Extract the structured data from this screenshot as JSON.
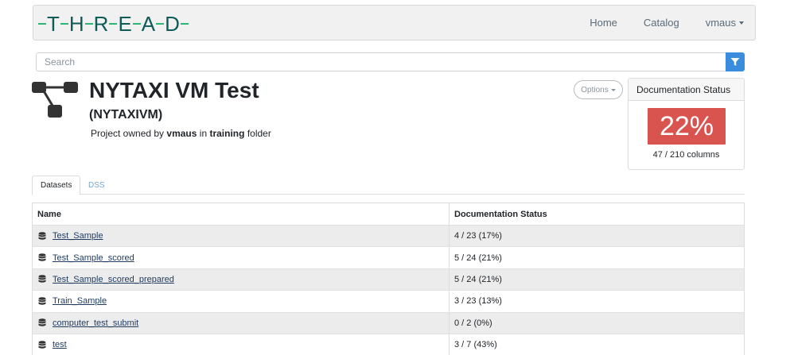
{
  "app": {
    "logo_letters": [
      "T",
      "H",
      "R",
      "E",
      "A",
      "D"
    ]
  },
  "nav": {
    "home": "Home",
    "catalog": "Catalog",
    "user": "vmaus"
  },
  "search": {
    "placeholder": "Search"
  },
  "project": {
    "title": "NYTAXI VM Test",
    "key": "(NYTAXIVM)",
    "owner_prefix": "Project owned by",
    "owner": "vmaus",
    "owner_mid": "in",
    "folder": "training",
    "owner_suffix": "folder",
    "options_label": "Options"
  },
  "doc_status": {
    "header": "Documentation Status",
    "percent": "22%",
    "columns": "47 / 210 columns",
    "color": "#d9534f"
  },
  "tabs": [
    {
      "label": "Datasets",
      "active": true
    },
    {
      "label": "DSS",
      "active": false
    }
  ],
  "table": {
    "columns": [
      "Name",
      "Documentation Status"
    ],
    "rows": [
      {
        "name": "Test_Sample",
        "status": "4 / 23 (17%)"
      },
      {
        "name": "Test_Sample_scored",
        "status": "5 / 24 (21%)"
      },
      {
        "name": "Test_Sample_scored_prepared",
        "status": "5 / 24 (21%)"
      },
      {
        "name": "Train_Sample",
        "status": "3 / 23 (13%)"
      },
      {
        "name": "computer_test_submit",
        "status": "0 / 2 (0%)"
      },
      {
        "name": "test",
        "status": "3 / 7 (43%)"
      }
    ]
  },
  "colors": {
    "accent": "#3a8ddc",
    "logo_primary": "#0d5c59",
    "logo_dash": "#2bb673"
  }
}
